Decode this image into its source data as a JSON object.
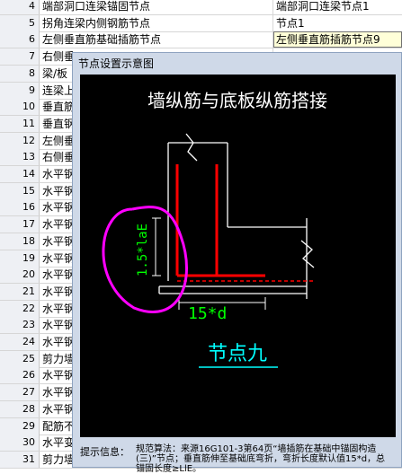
{
  "rows": [
    {
      "num": "4",
      "name": "端部洞口连梁锚固节点",
      "value": "端部洞口连梁节点1",
      "selected": false
    },
    {
      "num": "5",
      "name": "拐角连梁内侧钢筋节点",
      "value": "节点1",
      "selected": false
    },
    {
      "num": "6",
      "name": "左侧垂直筋基础插筋节点",
      "value": "左侧垂直筋插筋节点9",
      "selected": true
    },
    {
      "num": "7",
      "name": "右侧垂",
      "value": "",
      "selected": false
    },
    {
      "num": "8",
      "name": "梁/板",
      "value": "",
      "selected": false
    },
    {
      "num": "9",
      "name": "连梁上",
      "value": "",
      "selected": false
    },
    {
      "num": "10",
      "name": "垂直筋",
      "value": "",
      "selected": false
    },
    {
      "num": "11",
      "name": "垂直钢",
      "value": "",
      "selected": false
    },
    {
      "num": "12",
      "name": "左侧垂",
      "value": "",
      "selected": false
    },
    {
      "num": "13",
      "name": "右侧垂",
      "value": "",
      "selected": false
    },
    {
      "num": "14",
      "name": "水平钢",
      "value": "",
      "selected": false
    },
    {
      "num": "15",
      "name": "水平钢",
      "value": "",
      "selected": false
    },
    {
      "num": "16",
      "name": "水平钢",
      "value": "",
      "selected": false
    },
    {
      "num": "17",
      "name": "水平钢",
      "value": "",
      "selected": false
    },
    {
      "num": "18",
      "name": "水平钢",
      "value": "",
      "selected": false
    },
    {
      "num": "19",
      "name": "水平钢",
      "value": "",
      "selected": false
    },
    {
      "num": "20",
      "name": "水平钢",
      "value": "",
      "selected": false
    },
    {
      "num": "21",
      "name": "水平钢",
      "value": "",
      "selected": false
    },
    {
      "num": "22",
      "name": "水平钢",
      "value": "",
      "selected": false
    },
    {
      "num": "23",
      "name": "水平钢",
      "value": "",
      "selected": false
    },
    {
      "num": "24",
      "name": "水平钢",
      "value": "",
      "selected": false
    },
    {
      "num": "25",
      "name": "剪力墙",
      "value": "",
      "selected": false
    },
    {
      "num": "26",
      "name": "水平钢",
      "value": "",
      "selected": false
    },
    {
      "num": "27",
      "name": "水平钢",
      "value": "",
      "selected": false
    },
    {
      "num": "28",
      "name": "水平钢",
      "value": "",
      "selected": false
    },
    {
      "num": "29",
      "name": "配筋不",
      "value": "",
      "selected": false
    },
    {
      "num": "30",
      "name": "水平变",
      "value": "",
      "selected": false
    },
    {
      "num": "31",
      "name": "剪力墙",
      "value": "",
      "selected": false
    }
  ],
  "dialog": {
    "title": "节点设置示意图",
    "diagram_title": "墙纵筋与底板纵筋搭接",
    "dim_vertical": "1.5*laE",
    "dim_horizontal": "15*d",
    "node_label": "节点九",
    "hint_label": "提示信息：",
    "hint_text": "规范算法：来源16G101-3第64页“墙插筋在基础中锚固构造(三)”节点；垂直筋伸至基础底弯折，弯折长度默认值15*d，总锚固长度≥LlE。"
  },
  "colors": {
    "selected_value_bg": "#ffffd8",
    "dialog_bg": "#cfd9e8",
    "diagram_bg": "#000000",
    "rebar": "#ff0000",
    "dim_text": "#00ff00",
    "node_label": "#00ffff",
    "annotation": "#ff00ff"
  }
}
